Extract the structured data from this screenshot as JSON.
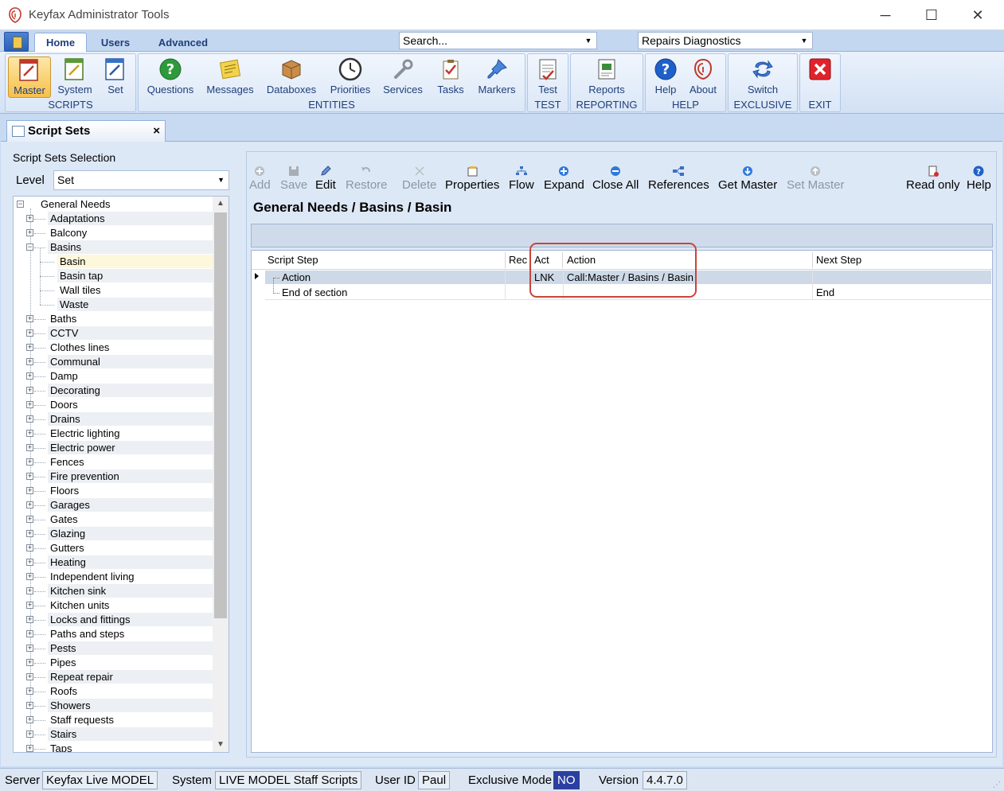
{
  "window": {
    "title": "Keyfax Administrator Tools"
  },
  "ribbon": {
    "tabs": [
      "Home",
      "Users",
      "Advanced"
    ],
    "search_placeholder": "Search...",
    "product_select": "Repairs Diagnostics",
    "groups": {
      "scripts": "SCRIPTS",
      "entities": "ENTITIES",
      "test": "TEST",
      "reporting": "REPORTING",
      "help": "HELP",
      "exclusive": "EXCLUSIVE",
      "exit": "EXIT"
    },
    "buttons": {
      "master": "Master",
      "system": "System",
      "set": "Set",
      "questions": "Questions",
      "messages": "Messages",
      "databoxes": "Databoxes",
      "priorities": "Priorities",
      "services": "Services",
      "tasks": "Tasks",
      "markers": "Markers",
      "test": "Test",
      "reports": "Reports",
      "help": "Help",
      "about": "About",
      "switch": "Switch"
    }
  },
  "doc_tab": {
    "title": "Script Sets",
    "close": "×"
  },
  "left": {
    "title": "Script Sets Selection",
    "level_label": "Level",
    "level_value": "Set",
    "root": "General Needs",
    "items": [
      "Adaptations",
      "Balcony",
      "Basins",
      "Baths",
      "CCTV",
      "Clothes lines",
      "Communal",
      "Damp",
      "Decorating",
      "Doors",
      "Drains",
      "Electric lighting",
      "Electric power",
      "Fences",
      "Fire prevention",
      "Floors",
      "Garages",
      "Gates",
      "Glazing",
      "Gutters",
      "Heating",
      "Independent living",
      "Kitchen sink",
      "Kitchen units",
      "Locks and fittings",
      "Paths and steps",
      "Pests",
      "Pipes",
      "Repeat repair",
      "Roofs",
      "Showers",
      "Staff requests",
      "Stairs",
      "Taps"
    ],
    "basins_children": [
      "Basin",
      "Basin tap",
      "Wall tiles",
      "Waste"
    ]
  },
  "toolbar": {
    "add": "Add",
    "save": "Save",
    "edit": "Edit",
    "restore": "Restore",
    "delete": "Delete",
    "properties": "Properties",
    "flow": "Flow",
    "expand": "Expand",
    "close_all": "Close All",
    "references": "References",
    "get_master": "Get Master",
    "set_master": "Set Master",
    "read_only": "Read only",
    "help": "Help"
  },
  "breadcrumb": "General Needs / Basins / Basin",
  "grid": {
    "headers": {
      "script_step": "Script Step",
      "rec": "Rec",
      "act": "Act",
      "action": "Action",
      "next_step": "Next Step"
    },
    "rows": [
      {
        "script_step": "Action",
        "rec": "",
        "act": "LNK",
        "action": "Call:Master / Basins / Basin",
        "next_step": ""
      },
      {
        "script_step": "End of section",
        "rec": "",
        "act": "",
        "action": "",
        "next_step": "End"
      }
    ]
  },
  "status": {
    "server_label": "Server",
    "server_value": "Keyfax Live MODEL",
    "system_label": "System",
    "system_value": "LIVE MODEL Staff Scripts",
    "user_label": "User ID",
    "user_value": "Paul",
    "exclusive_label": "Exclusive Mode",
    "exclusive_value": "NO",
    "version_label": "Version",
    "version_value": "4.4.7.0"
  }
}
